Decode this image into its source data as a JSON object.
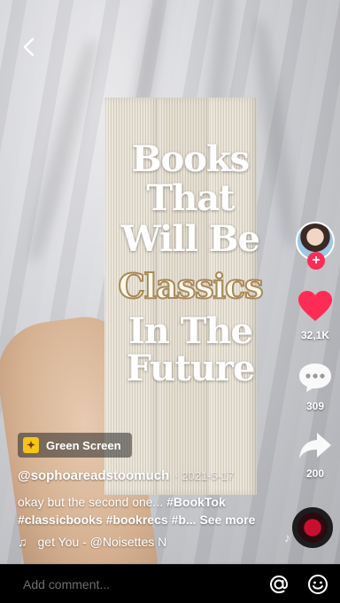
{
  "video": {
    "overlay_lines": [
      "Books",
      "That",
      "Will Be",
      "Classics",
      "In The",
      "Future"
    ]
  },
  "nav": {
    "back_icon": "chevron-left-icon"
  },
  "rail": {
    "avatar_icon": "creator-avatar",
    "follow_icon": "plus-icon",
    "likes_count": "32,1K",
    "comments_count": "309",
    "shares_count": "200",
    "music_disc_icon": "music-disc-icon"
  },
  "effect": {
    "label": "Green Screen",
    "icon": "green-screen-effect-icon"
  },
  "post": {
    "author": "@sophoareadstoomuch",
    "date": "· 2021-5-17",
    "caption_text": "okay but the second one... ",
    "caption_tag1": "#BookTok",
    "caption_tags2": "#classicbooks #bookrecs #b...",
    "see_more": "See more"
  },
  "music": {
    "note": "♫",
    "track": "get You - @Noisettes   N"
  },
  "bottom": {
    "comment_placeholder": "Add comment...",
    "mention_icon": "at-icon",
    "emoji_icon": "emoji-icon"
  },
  "colors": {
    "like_red": "#fe2c55",
    "background": "#000000"
  }
}
